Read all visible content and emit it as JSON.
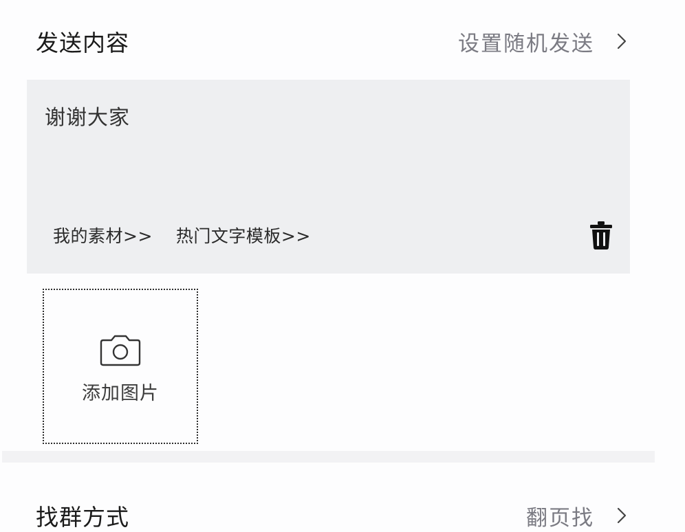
{
  "send_section": {
    "title": "发送内容",
    "random_send_label": "设置随机发送",
    "message": "谢谢大家",
    "links": {
      "my_materials": "我的素材>>",
      "hot_templates": "热门文字模板>>"
    },
    "add_image_label": "添加图片"
  },
  "find_section": {
    "title": "找群方式",
    "value_label": "翻页找"
  },
  "icons": {
    "chevron": "chevron-right-icon",
    "trash": "trash-icon",
    "camera": "camera-icon"
  }
}
